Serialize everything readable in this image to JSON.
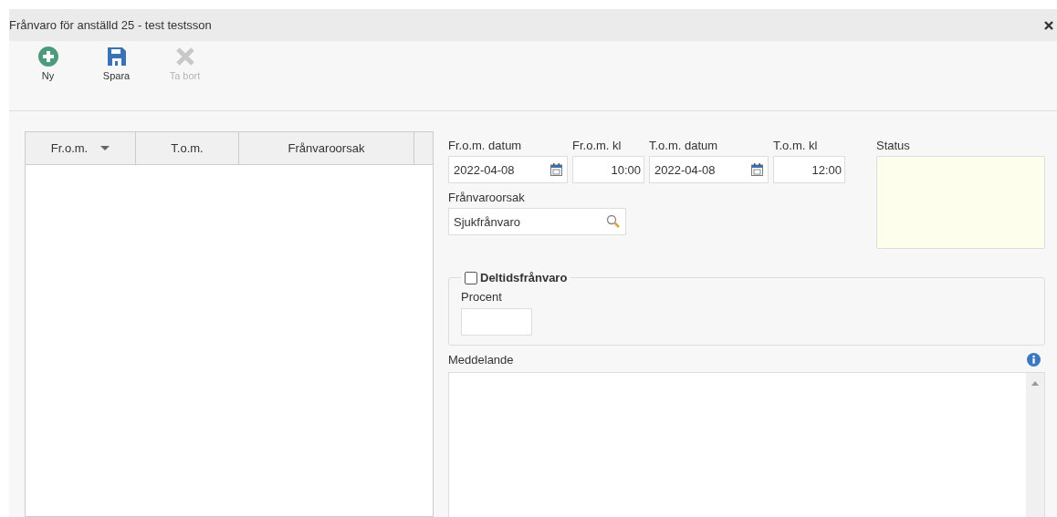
{
  "window": {
    "title": "Frånvaro för anställd 25 - test testsson"
  },
  "toolbar": [
    {
      "label": "Ny",
      "kind": "add",
      "disabled": false
    },
    {
      "label": "Spara",
      "kind": "save",
      "disabled": false
    },
    {
      "label": "Ta bort",
      "kind": "delete",
      "disabled": true
    }
  ],
  "table": {
    "columns": [
      {
        "label": "Fr.o.m.",
        "sorted": true
      },
      {
        "label": "T.o.m.",
        "sorted": false
      },
      {
        "label": "Frånvaroorsak",
        "sorted": false
      }
    ]
  },
  "form": {
    "fields": [
      {
        "label": "Fr.o.m. datum",
        "value": "2022-04-08",
        "kind": "date"
      },
      {
        "label": "Fr.o.m. kl",
        "value": "10:00",
        "kind": "time"
      },
      {
        "label": "T.o.m. datum",
        "value": "2022-04-08",
        "kind": "date"
      },
      {
        "label": "T.o.m. kl",
        "value": "12:00",
        "kind": "time"
      }
    ],
    "status": {
      "label": "Status"
    },
    "reason": {
      "label": "Frånvaroorsak",
      "value": "Sjukfrånvaro"
    },
    "part_time": {
      "label": "Deltidsfrånvaro",
      "checked": false,
      "percent_label": "Procent"
    },
    "message": {
      "label": "Meddelande"
    }
  }
}
